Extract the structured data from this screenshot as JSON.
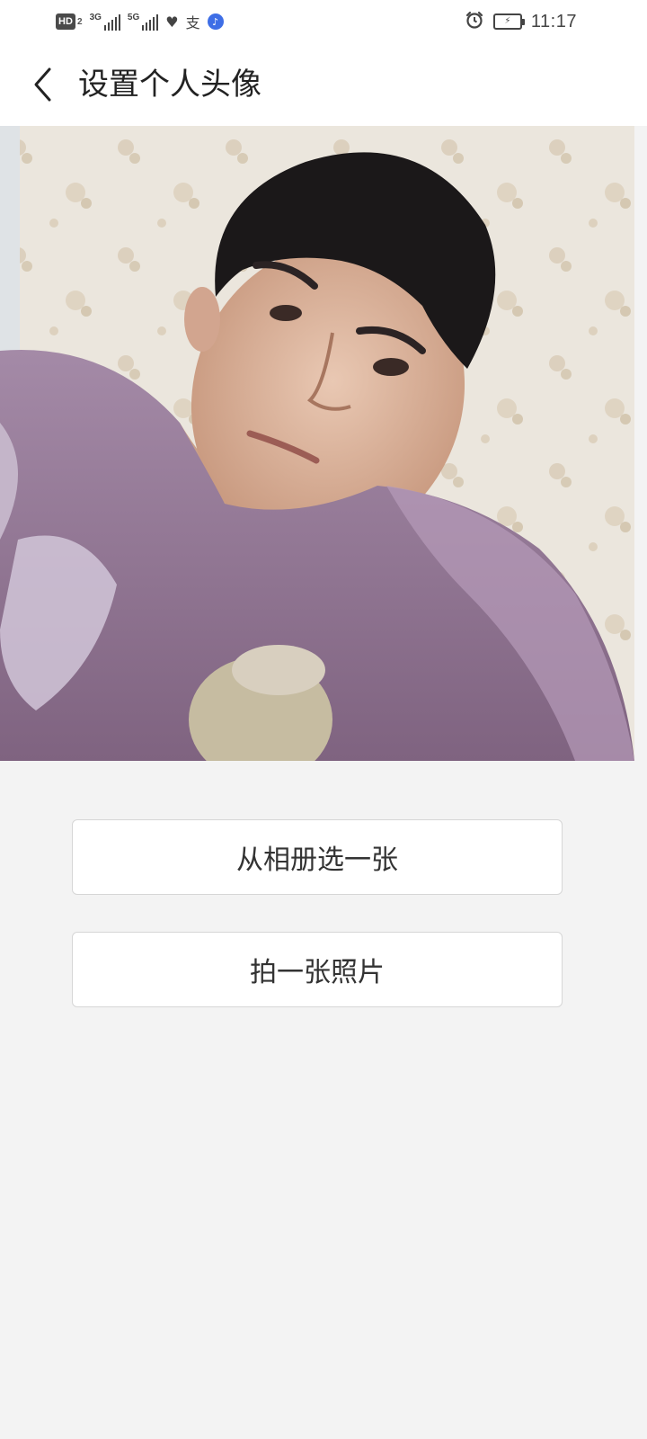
{
  "status_bar": {
    "hd_label": "HD",
    "hd_sub": "2",
    "network1_label": "3G",
    "network2_label": "5G",
    "time": "11:17",
    "icons": [
      "hd-badge-icon",
      "signal-3g-icon",
      "signal-5g-icon",
      "health-heart-icon",
      "alipay-icon",
      "music-icon",
      "alarm-icon",
      "battery-charging-icon"
    ]
  },
  "header": {
    "title": "设置个人头像",
    "back_icon": "chevron-left-icon"
  },
  "photo": {
    "subject": "avatar-preview-image"
  },
  "actions": {
    "choose_from_album": "从相册选一张",
    "take_photo": "拍一张照片"
  },
  "colors": {
    "background": "#f3f3f3",
    "header_background": "#ffffff",
    "button_border": "#d6d6d6",
    "text": "#222222"
  }
}
